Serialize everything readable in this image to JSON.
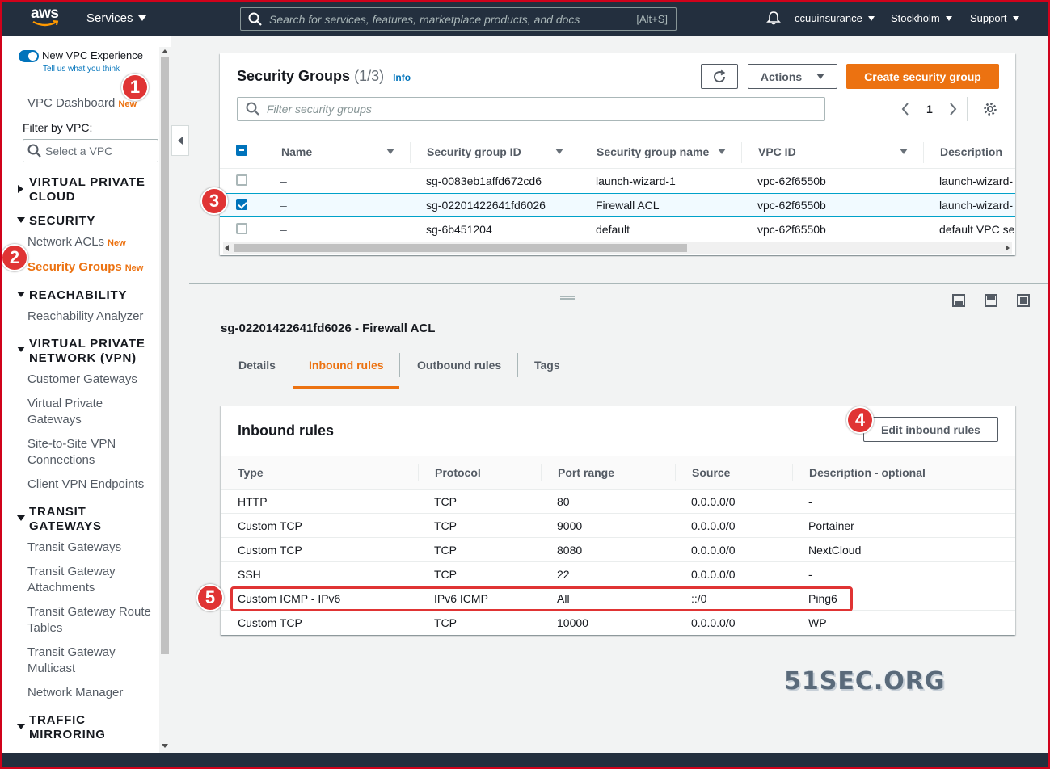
{
  "topnav": {
    "logo_text": "aws",
    "services_label": "Services",
    "search_placeholder": "Search for services, features, marketplace products, and docs",
    "search_shortcut": "[Alt+S]",
    "account": "ccuuinsurance",
    "region": "Stockholm",
    "support": "Support"
  },
  "sidebar": {
    "new_vpc_experience": "New VPC Experience",
    "tell_us": "Tell us what you think",
    "dashboard": "VPC Dashboard",
    "new_badge": "New",
    "filter_label": "Filter by VPC:",
    "filter_placeholder": "Select a VPC",
    "section_vpc": "VIRTUAL PRIVATE CLOUD",
    "section_security": "SECURITY",
    "network_acls": "Network ACLs",
    "security_groups": "Security Groups",
    "section_reachability": "REACHABILITY",
    "reachability_analyzer": "Reachability Analyzer",
    "section_vpn": "VIRTUAL PRIVATE NETWORK (VPN)",
    "customer_gateways": "Customer Gateways",
    "virtual_private_gateways": "Virtual Private Gateways",
    "site_to_site": "Site-to-Site VPN Connections",
    "client_vpn": "Client VPN Endpoints",
    "section_transit": "TRANSIT GATEWAYS",
    "transit_gateways": "Transit Gateways",
    "tg_attachments": "Transit Gateway Attachments",
    "tg_route_tables": "Transit Gateway Route Tables",
    "tg_multicast": "Transit Gateway Multicast",
    "network_manager": "Network Manager",
    "section_mirroring": "TRAFFIC MIRRORING"
  },
  "sg_panel": {
    "title": "Security Groups",
    "count": "(1/3)",
    "info": "Info",
    "actions": "Actions",
    "create": "Create security group",
    "filter_placeholder": "Filter security groups",
    "page": "1",
    "columns": [
      "Name",
      "Security group ID",
      "Security group name",
      "VPC ID",
      "Description"
    ],
    "rows": [
      {
        "name": "–",
        "id": "sg-0083eb1affd672cd6",
        "group_name": "launch-wizard-1",
        "vpc": "vpc-62f6550b",
        "desc": "launch-wizard-",
        "selected": false
      },
      {
        "name": "–",
        "id": "sg-02201422641fd6026",
        "group_name": "Firewall ACL",
        "vpc": "vpc-62f6550b",
        "desc": "launch-wizard-",
        "selected": true
      },
      {
        "name": "–",
        "id": "sg-6b451204",
        "group_name": "default",
        "vpc": "vpc-62f6550b",
        "desc": "default VPC se",
        "selected": false
      }
    ]
  },
  "detail": {
    "title": "sg-02201422641fd6026 - Firewall ACL",
    "tabs": [
      "Details",
      "Inbound rules",
      "Outbound rules",
      "Tags"
    ],
    "active_tab": "Inbound rules"
  },
  "inbound": {
    "title": "Inbound rules",
    "edit_button": "Edit inbound rules",
    "columns": [
      "Type",
      "Protocol",
      "Port range",
      "Source",
      "Description - optional"
    ],
    "rows": [
      [
        "HTTP",
        "TCP",
        "80",
        "0.0.0.0/0",
        "-"
      ],
      [
        "Custom TCP",
        "TCP",
        "9000",
        "0.0.0.0/0",
        "Portainer"
      ],
      [
        "Custom TCP",
        "TCP",
        "8080",
        "0.0.0.0/0",
        "NextCloud"
      ],
      [
        "SSH",
        "TCP",
        "22",
        "0.0.0.0/0",
        "-"
      ],
      [
        "Custom ICMP - IPv6",
        "IPv6 ICMP",
        "All",
        "::/0",
        "Ping6"
      ],
      [
        "Custom TCP",
        "TCP",
        "10000",
        "0.0.0.0/0",
        "WP"
      ]
    ],
    "highlighted_row": 4
  },
  "callouts": [
    "1",
    "2",
    "3",
    "4",
    "5"
  ],
  "watermark": "51SEC.ORG",
  "colors": {
    "nav_bg": "#232f3e",
    "accent_orange": "#ec7211",
    "link_blue": "#0073bb",
    "callout_red": "#e03434",
    "frame_red": "#d0021b"
  }
}
